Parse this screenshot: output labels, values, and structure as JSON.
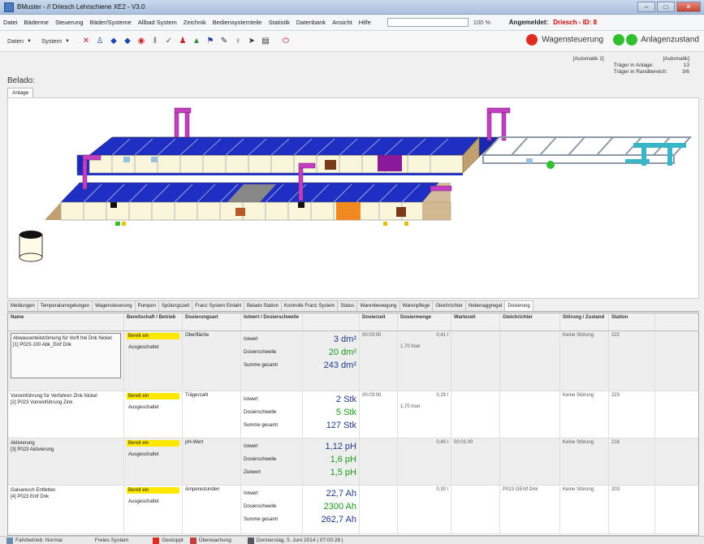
{
  "window": {
    "title": "BMuster - // Driesch Lehrschiene XE2 - V3.0",
    "buttons": [
      "–",
      "□",
      "✕"
    ]
  },
  "menu": {
    "items": [
      "Datei",
      "Bäderme",
      "Steuerung",
      "Bäder/Systeme",
      "Allbad System",
      "Zeichnik",
      "Bediensystemteile",
      "Statistik",
      "Datenbank",
      "Ansicht",
      "Hilfe"
    ],
    "progress_text": "100 %",
    "logged_label": "Angemeldet:",
    "logged_user": "Driesch - ID: 8"
  },
  "toolbar": {
    "dropdown1": "Daten",
    "dropdown2": "System",
    "icons": [
      "cross-icon",
      "person-icon",
      "fish-icon",
      "fish-icon",
      "circle-icon",
      "pause-icon",
      "check-icon",
      "person-icon",
      "tree-icon",
      "flag-icon",
      "pen-icon",
      "figure-icon",
      "arrow-icon",
      "list-icon",
      "power-icon"
    ]
  },
  "status": {
    "wagen_label": "Wagensteuerung",
    "wagen_color": "#e02b20",
    "anlage_label": "Anlagenzustand",
    "anlage_color": "#2fbf2f"
  },
  "info": {
    "auto1": "[Automatik 2]",
    "auto2": "[Automatik]",
    "row1_label": "Träger in Anlage:",
    "row1_val": "13",
    "row2_label": "Träger in Randbereich:",
    "row2_val": "3/6"
  },
  "view": {
    "section_title": "Belado:",
    "tab": "Anlage"
  },
  "bottom_tabs": [
    "Meldungen",
    "Temperaturregelungen",
    "Wagensteuerung",
    "Pumpen",
    "Spülungszeit",
    "Franz System Einlahl",
    "Belado Station",
    "Kontrolle Franz System",
    "Status",
    "Warenbewegung",
    "Warenpflege",
    "Gleichrichter",
    "Nebenaggregat",
    "Dosierung"
  ],
  "active_tab": "Dosierung",
  "table": {
    "headers": [
      "Name",
      "Bereitschaft / Betrieb",
      "Dosierungsart",
      "Istwert / Dosierschwelle",
      "",
      "Dosierzeit",
      "Dosiermenge",
      "Wartezeit",
      "Gleichrichter",
      "Störung / Zustand",
      "Station"
    ],
    "rows": [
      {
        "name": "Abwasserteilströmung für Vorfl frei Dnk Nickel\n[1] P023-100 Abk_Einf Dnk",
        "ready": "Bereit ein",
        "off": "Ausgeschaltet",
        "art": "Oberfläche",
        "labels": [
          "Istwert",
          "Dosierschwelle",
          "Summe gesamt"
        ],
        "values": [
          "3 dm²",
          "20 dm²",
          "243 dm²"
        ],
        "dosierzeit": "00:03:00",
        "menge": "1,70 l/ser",
        "menge2": "0,41 l",
        "wartezeit": "",
        "gleich": "",
        "stoerung": "Keine Störung",
        "station": "222"
      },
      {
        "name": "Vorreinführung für Verfahren Zink Nickel\n[2] P023 Vorreinführung Zink",
        "ready": "Bereit ein",
        "off": "Ausgeschaltet",
        "art": "Trägerzahl",
        "labels": [
          "Istwert",
          "Dosierschwelle",
          "Summe gesamt"
        ],
        "values": [
          "2 Stk",
          "5 Stk",
          "127 Stk"
        ],
        "dosierzeit": "00:03:00",
        "menge": "1,70 l/ser",
        "menge2": "0,29 l",
        "wartezeit": "",
        "gleich": "",
        "stoerung": "Keine Störung",
        "station": "223"
      },
      {
        "name": "Aktivierung\n[3] P023 Aktivierung",
        "ready": "Bereit ein",
        "off": "Ausgeschaltet",
        "art": "pH-Wert",
        "labels": [
          "Istwert",
          "Dosierschwelle",
          "Zielwert"
        ],
        "values": [
          "1,12 pH",
          "1,6 pH",
          "1,5 pH"
        ],
        "dosierzeit": "",
        "menge": "",
        "menge2": "0,40 l",
        "wartezeit": "00:01:00",
        "gleich": "",
        "stoerung": "Keine Störung",
        "station": "216"
      },
      {
        "name": "Galvanisch Entfetten\n[4] P023 Entf Dnk",
        "ready": "Bereit ein",
        "off": "Ausgeschaltet",
        "art": "Amperestunden",
        "labels": [
          "Istwert",
          "Dosierschwelle",
          "Summe gesamt"
        ],
        "values": [
          "22,7 Ah",
          "2300 Ah",
          "262,7 Ah"
        ],
        "dosierzeit": "",
        "menge": "",
        "menge2": "0,30 l",
        "wartezeit": "",
        "gleich": "P023 GEntf Dnk",
        "stoerung": "Keine Störung",
        "station": "203"
      }
    ]
  },
  "statusbar": {
    "item1": "Fahrbetrieb: Normal",
    "item2": "Freies System",
    "item3": "Gestoppt",
    "item4": "Überwachung",
    "item5": "Donnerstag, 5. Juni 2014 | 07:00:28 |"
  }
}
